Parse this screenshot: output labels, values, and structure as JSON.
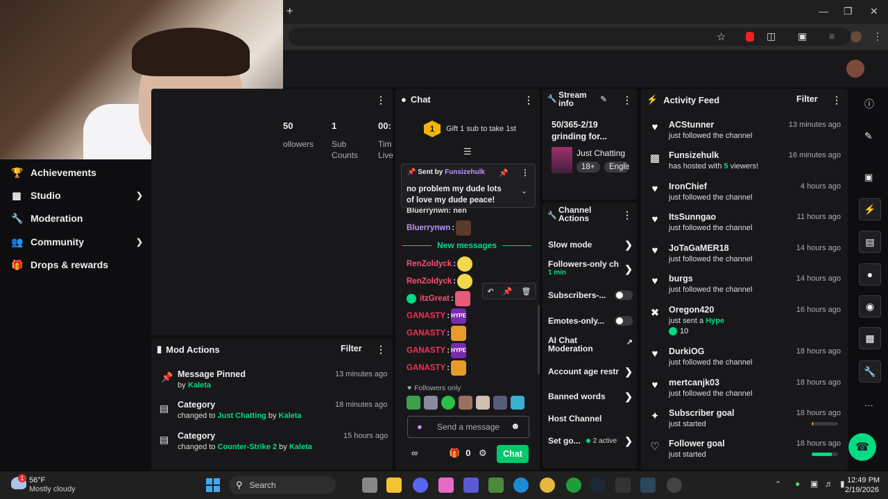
{
  "browser": {
    "new_tab_icon": "plus-icon"
  },
  "sidebar": {
    "items": [
      {
        "label": "Achievements",
        "icon": "trophy-icon"
      },
      {
        "label": "Studio",
        "icon": "film-icon",
        "expandable": true
      },
      {
        "label": "Moderation",
        "icon": "wrench-icon"
      },
      {
        "label": "Community",
        "icon": "people-icon",
        "expandable": true
      },
      {
        "label": "Drops & rewards",
        "icon": "gift-icon"
      }
    ]
  },
  "stats": {
    "followers_value": "50",
    "followers_label": "ollowers",
    "subs_value": "1",
    "subs_label_1": "Sub",
    "subs_label_2": "Counts",
    "time_value": "00:",
    "time_label_1": "Tim",
    "time_label_2": "Live"
  },
  "mod_actions": {
    "title": "Mod Actions",
    "filter": "Filter",
    "rows": [
      {
        "title": "Message Pinned",
        "by_prefix": "by",
        "by": "Kaleta",
        "time": "13 minutes ago",
        "icon": "pin-icon"
      },
      {
        "title": "Category",
        "prefix": "changed to",
        "value": "Just Chatting",
        "by_prefix": "by",
        "by": "Kaleta",
        "time": "18 minutes ago",
        "icon": "category-icon"
      },
      {
        "title": "Category",
        "prefix": "changed to",
        "value": "Counter-Strike 2",
        "by_prefix": "by",
        "by": "Kaleta",
        "time": "15 hours ago",
        "icon": "category-icon"
      }
    ]
  },
  "chat": {
    "title": "Chat",
    "gift_count": "1",
    "gift_text": "Gift 1 sub to take 1st",
    "pinned": {
      "sent_by_label": "Sent by",
      "sender": "Funsizehulk",
      "text": "no problem my dude lots of love my dude peace!"
    },
    "partial_line": "Bluerrynwn: nen",
    "messages": [
      {
        "user": "Bluerrynwn",
        "color": "#bf94ff"
      },
      {
        "user": "RenZoldyck",
        "color": "#ff4f73"
      },
      {
        "user": "RenZoldyck",
        "color": "#ff4f73"
      },
      {
        "user": "itzGreat",
        "color": "#ff4f73",
        "badge": true
      },
      {
        "user": "GANASTY",
        "color": "#ff2d55",
        "emote": "HYPE"
      },
      {
        "user": "GANASTY",
        "color": "#ff2d55"
      },
      {
        "user": "GANASTY",
        "color": "#ff2d55",
        "emote": "HYPE"
      },
      {
        "user": "GANASTY",
        "color": "#ff2d55"
      }
    ],
    "new_messages": "New messages",
    "followers_only": "Followers only",
    "input_placeholder": "Send a message",
    "bits_count": "0",
    "chat_button": "Chat"
  },
  "stream_info": {
    "title_1": "Stream",
    "title_2": "info",
    "stream_title": "50/365-2/19 grinding for...",
    "category": "Just Chatting",
    "tag_1": "18+",
    "tag_2": "Englis"
  },
  "channel_actions": {
    "title_1": "Channel",
    "title_2": "Actions",
    "rows": [
      {
        "label": "Slow mode",
        "type": "arrow"
      },
      {
        "label": "Followers-only ch",
        "sub": "1 min",
        "type": "arrow"
      },
      {
        "label": "Subscribers-...",
        "type": "toggle"
      },
      {
        "label": "Emotes-only...",
        "type": "toggle"
      },
      {
        "label": "AI Chat Moderation",
        "type": "external"
      },
      {
        "label": "Account age restr",
        "type": "arrow"
      },
      {
        "label": "Banned words",
        "type": "arrow"
      },
      {
        "label": "Host Channel",
        "type": "none"
      },
      {
        "label": "Set go...",
        "sub": "2 active",
        "type": "arrow"
      }
    ]
  },
  "activity": {
    "title": "Activity Feed",
    "filter": "Filter",
    "items": [
      {
        "name": "ACStunner",
        "sub": "just followed the channel",
        "time": "13 minutes ago",
        "icon": "heart-icon"
      },
      {
        "name": "Funsizehulk",
        "sub_pre": "has hosted with",
        "sub_hl": "5",
        "sub_post": "viewers!",
        "time": "16 minutes ago",
        "icon": "host-icon"
      },
      {
        "name": "IronChief",
        "sub": "just followed the channel",
        "time": "4 hours ago",
        "icon": "heart-icon"
      },
      {
        "name": "ItsSunngao",
        "sub": "just followed the channel",
        "time": "11 hours ago",
        "icon": "heart-icon"
      },
      {
        "name": "JoTaGaMER18",
        "sub": "just followed the channel",
        "time": "14 hours ago",
        "icon": "heart-icon"
      },
      {
        "name": "burgs",
        "sub": "just followed the channel",
        "time": "14 hours ago",
        "icon": "heart-icon"
      },
      {
        "name": "Oregon420",
        "sub_pre": "just sent a",
        "sub_hl": "Hype",
        "time": "16 hours ago",
        "extra": "10",
        "icon": "hype-icon"
      },
      {
        "name": "DurkiOG",
        "sub": "just followed the channel",
        "time": "18 hours ago",
        "icon": "heart-icon"
      },
      {
        "name": "mertcanjk03",
        "sub": "just followed the channel",
        "time": "18 hours ago",
        "icon": "heart-icon"
      },
      {
        "name": "Subscriber goal",
        "sub": "just started",
        "time": "18 hours ago",
        "icon": "sparkle-icon",
        "progress": 0.05
      },
      {
        "name": "Follower goal",
        "sub": "just started",
        "time": "18 hours ago",
        "icon": "heart-outline-icon",
        "progress": 0.75
      }
    ]
  },
  "taskbar": {
    "temp": "56°F",
    "weather": "Mostly cloudy",
    "weather_badge": "1",
    "search": "Search",
    "time": "12:49 PM",
    "date": "2/19/2026"
  },
  "colors": {
    "accent": "#00db84",
    "purple": "#bf94ff",
    "bg": "#0e0e10",
    "panel": "#18181b"
  }
}
